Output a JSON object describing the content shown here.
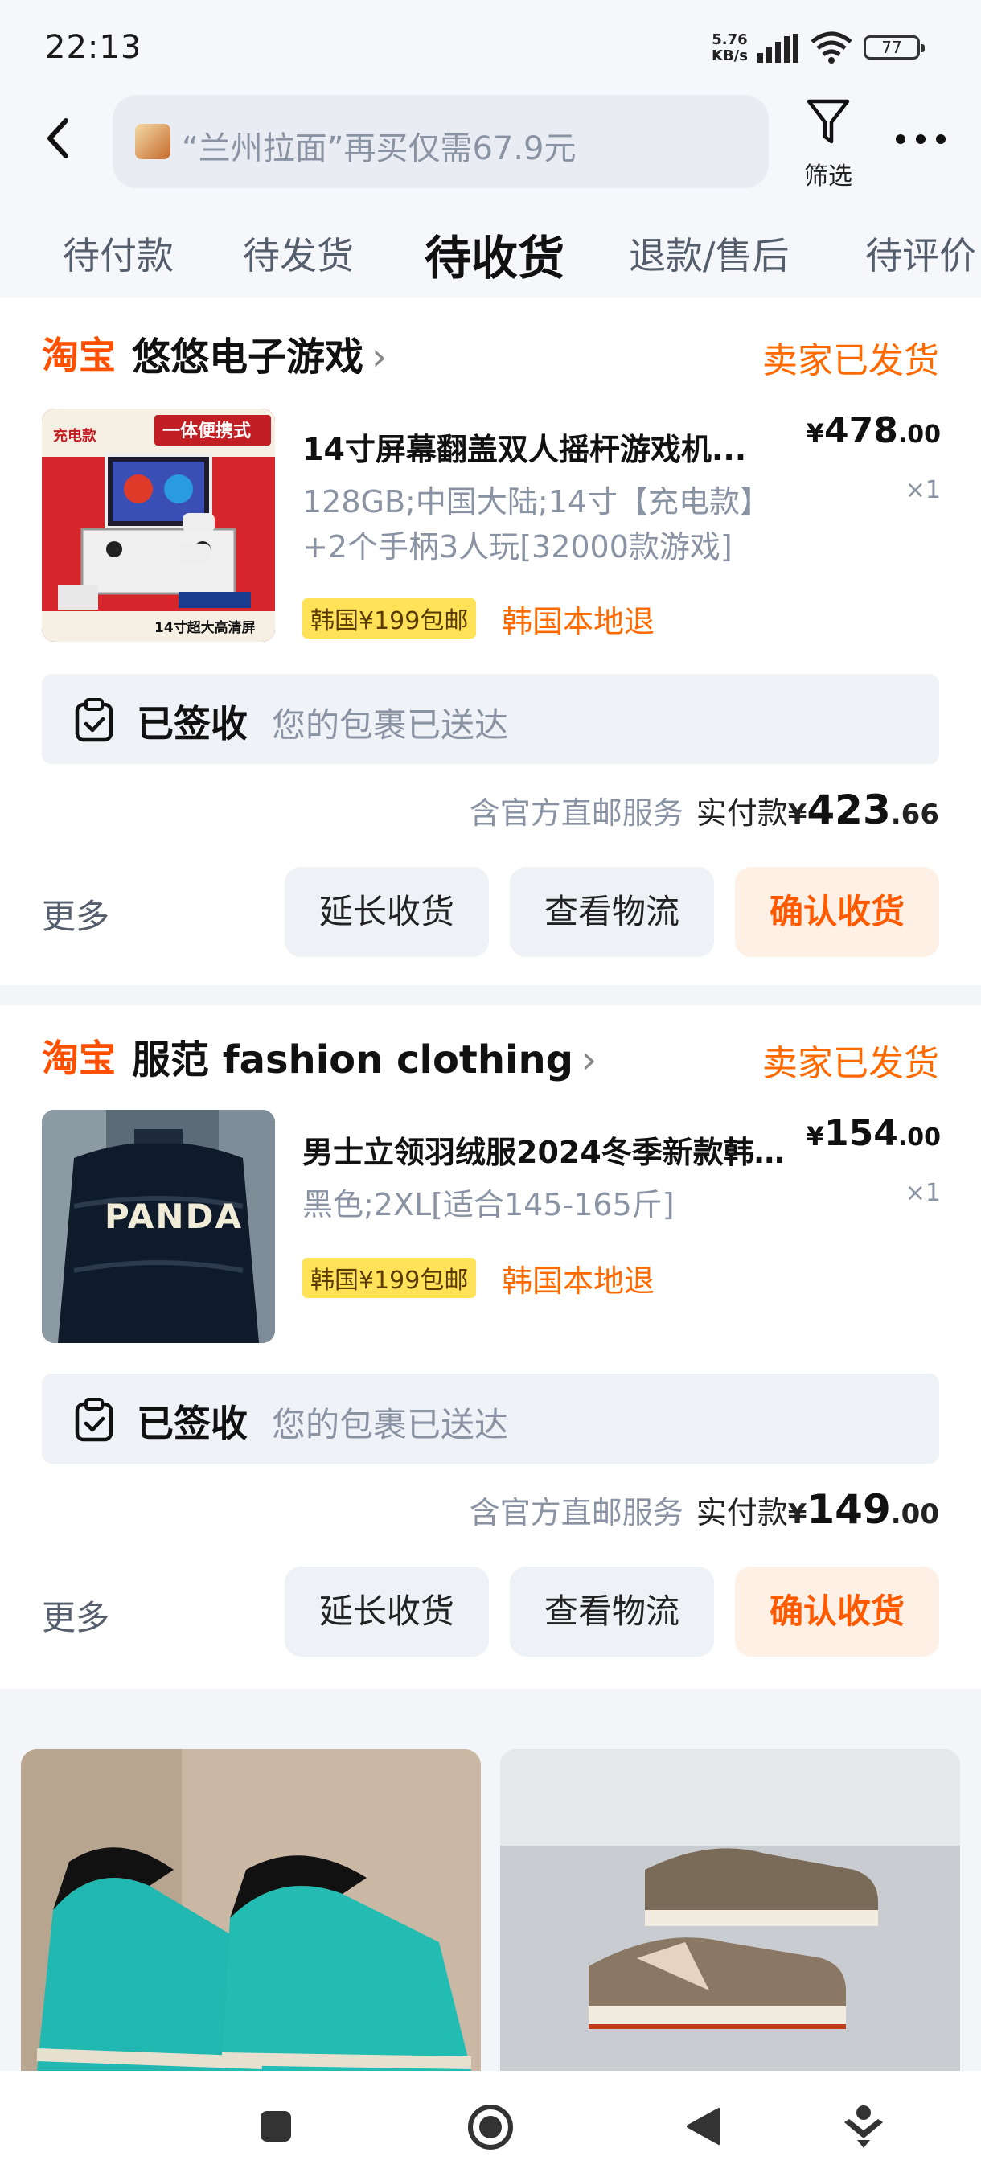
{
  "status_bar": {
    "time": "22:13",
    "net_speed_value": "5.76",
    "net_speed_unit": "KB/s",
    "battery": "77"
  },
  "header": {
    "search_placeholder": "“兰州拉面”再买仅需67.9元",
    "filter_label": "筛选"
  },
  "tabs": [
    {
      "label": "待付款"
    },
    {
      "label": "待发货"
    },
    {
      "label": "待收货",
      "active": true
    },
    {
      "label": "退款/售后"
    },
    {
      "label": "待评价"
    }
  ],
  "orders": [
    {
      "platform": "淘宝",
      "shop": "悠悠电子游戏",
      "status": "卖家已发货",
      "product_title": "14寸屏幕翻盖双人摇杆游戏机...",
      "price_currency": "¥",
      "price_int": "478",
      "price_dec": ".00",
      "quantity": "×1",
      "sku_line1": "128GB;中国大陆;14寸【充电款】",
      "sku_line2": "+2个手柄3人玩[32000款游戏]",
      "shipping_badge": "韩国¥199包邮",
      "return_tag": "韩国本地退",
      "delivery_title": "已签收",
      "delivery_desc": "您的包裹已送达",
      "service": "含官方直邮服务",
      "paid_label": "实付款",
      "paid_currency": "¥",
      "paid_int": "423",
      "paid_dec": ".66",
      "more": "更多",
      "btn_extend": "延长收货",
      "btn_logistics": "查看物流",
      "btn_confirm": "确认收货",
      "thumb_text_top": "一体便携式",
      "thumb_text_badge": "充电款",
      "thumb_text_bottom": "14寸超大高清屏"
    },
    {
      "platform": "淘宝",
      "shop": "服范 fashion clothing",
      "status": "卖家已发货",
      "product_title": "男士立领羽绒服2024冬季新款韩...",
      "price_currency": "¥",
      "price_int": "154",
      "price_dec": ".00",
      "quantity": "×1",
      "sku_line1": "黑色;2XL[适合145-165斤]",
      "shipping_badge": "韩国¥199包邮",
      "return_tag": "韩国本地退",
      "delivery_title": "已签收",
      "delivery_desc": "您的包裹已送达",
      "service": "含官方直邮服务",
      "paid_label": "实付款",
      "paid_currency": "¥",
      "paid_int": "149",
      "paid_dec": ".00",
      "more": "更多",
      "btn_extend": "延长收货",
      "btn_logistics": "查看物流",
      "btn_confirm": "确认收货",
      "thumb_text": "PANDA"
    }
  ],
  "colors": {
    "accent": "#ff5000",
    "status_orange": "#ff6a00",
    "badge_yellow": "#ffe258",
    "muted": "#8a93a3"
  },
  "icons": [
    "back-icon",
    "filter-icon",
    "more-icon",
    "clipboard-check-icon",
    "square-nav-icon",
    "home-circle-icon",
    "back-triangle-icon",
    "assistant-icon"
  ]
}
